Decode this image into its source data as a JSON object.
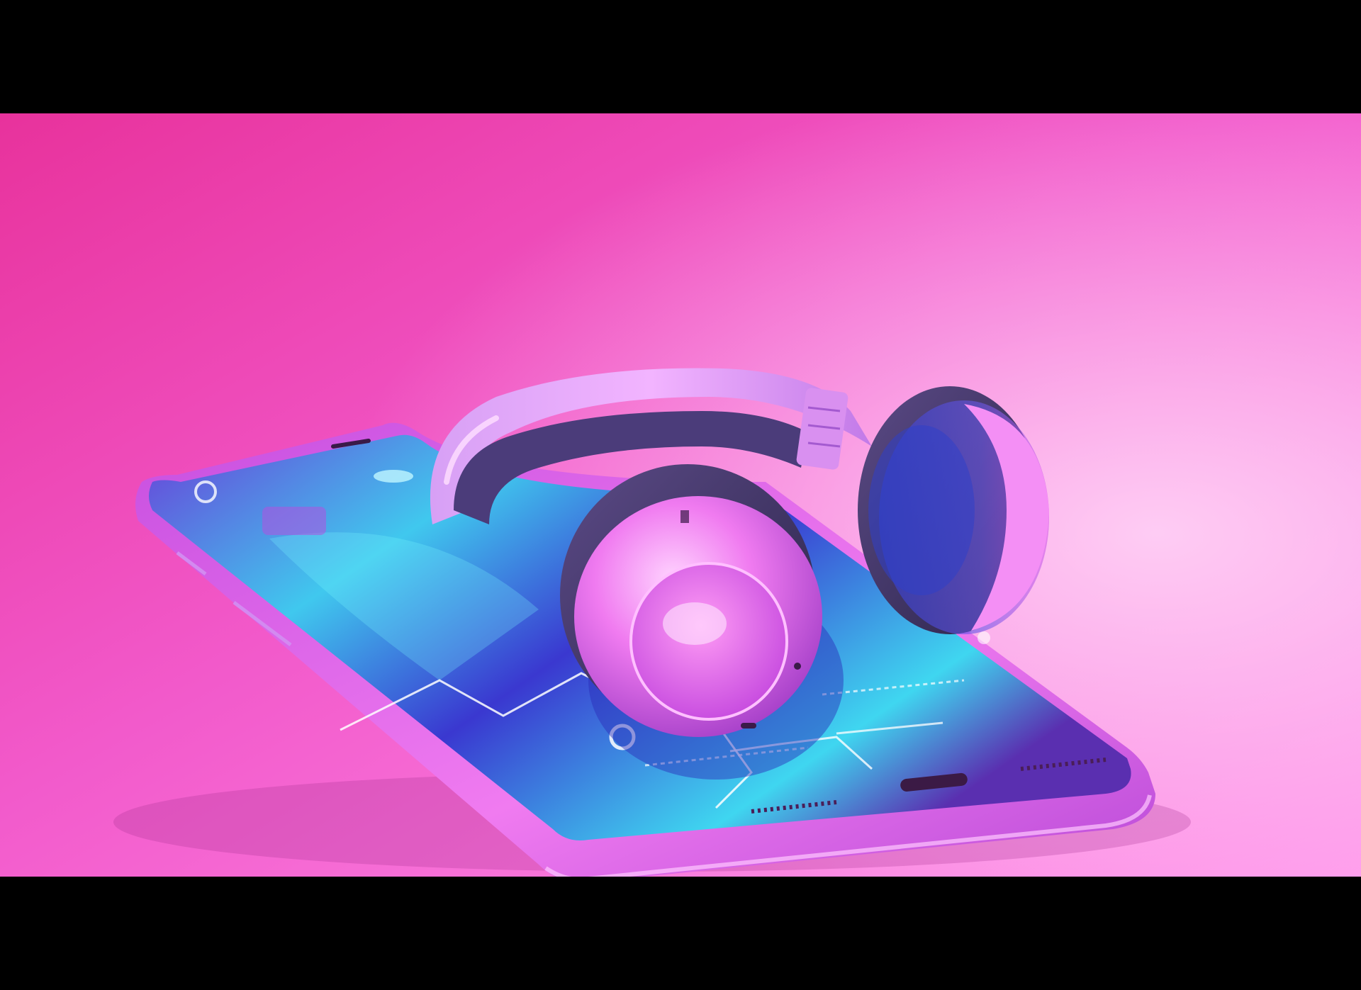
{
  "scene": {
    "subject": "headphones-on-smartphone",
    "colors": {
      "background_top": "#e8329c",
      "background_bottom": "#ff7ae6",
      "phone_body": "#e45fe8",
      "screen_cyan": "#3fd6f0",
      "screen_blue": "#3b3ad8",
      "headphone_pink": "#f07bf0",
      "cushion_dark": "#3a2f5e",
      "letterbox": "#000000"
    }
  }
}
